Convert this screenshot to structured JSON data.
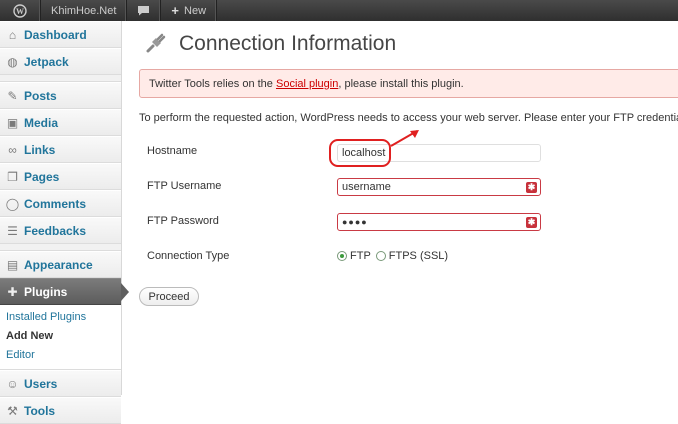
{
  "adminbar": {
    "site_name": "KhimHoe.Net",
    "new_label": "New"
  },
  "sidebar": {
    "items": [
      {
        "label": "Dashboard",
        "icon": "dashboard-icon"
      },
      {
        "label": "Jetpack",
        "icon": "jetpack-icon"
      },
      {
        "label": "Posts",
        "icon": "pin-icon"
      },
      {
        "label": "Media",
        "icon": "media-icon"
      },
      {
        "label": "Links",
        "icon": "link-icon"
      },
      {
        "label": "Pages",
        "icon": "pages-icon"
      },
      {
        "label": "Comments",
        "icon": "comment-icon"
      },
      {
        "label": "Feedbacks",
        "icon": "feedback-icon"
      },
      {
        "label": "Appearance",
        "icon": "appearance-icon"
      },
      {
        "label": "Plugins",
        "icon": "plugin-icon"
      },
      {
        "label": "Users",
        "icon": "users-icon"
      },
      {
        "label": "Tools",
        "icon": "tools-icon"
      }
    ],
    "submenu": [
      "Installed Plugins",
      "Add New",
      "Editor"
    ]
  },
  "page": {
    "title": "Connection Information",
    "notice_prefix": "Twitter Tools relies on the ",
    "notice_link": "Social plugin",
    "notice_suffix": ", please install this plugin.",
    "description": "To perform the requested action, WordPress needs to access your web server. Please enter your FTP credentials to"
  },
  "form": {
    "hostname_label": "Hostname",
    "hostname_value": "localhost",
    "username_label": "FTP Username",
    "username_value": "username",
    "password_label": "FTP Password",
    "password_value": "●●●●",
    "connection_label": "Connection Type",
    "option_ftp": "FTP",
    "option_ftps": "FTPS (SSL)",
    "selected": "FTP",
    "proceed_label": "Proceed"
  },
  "colors": {
    "link": "#21759b",
    "error": "#c93a44",
    "annotation": "#e02020"
  }
}
